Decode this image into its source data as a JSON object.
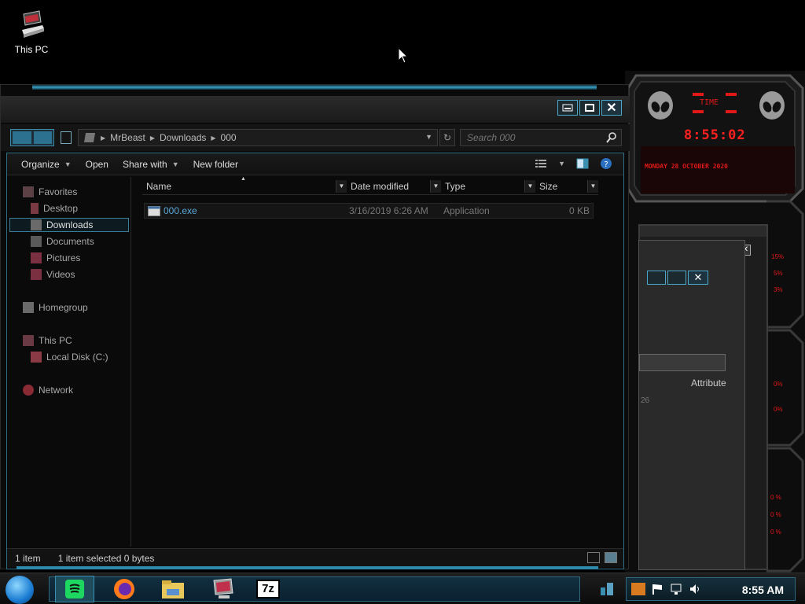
{
  "desktop": {
    "icons": [
      {
        "label": "This PC",
        "icon": "computer-icon"
      }
    ]
  },
  "gadget": {
    "time_label": "TIME",
    "time": "8:55:02",
    "date": "MONDAY 28 OCTOBER 2020",
    "meters": [
      "15%",
      "5%",
      "3%",
      "0%",
      "0%",
      "0 %",
      "0 %",
      "0 %"
    ],
    "colors": {
      "accent": "#e01818",
      "panel": "#1a1a1a"
    }
  },
  "back_window": {
    "column_header": "Attribute",
    "partial_value": "26"
  },
  "explorer": {
    "address": {
      "crumbs": [
        "MrBeast",
        "Downloads",
        "000"
      ]
    },
    "search": {
      "placeholder": "Search 000"
    },
    "toolbar": {
      "organize": "Organize",
      "open": "Open",
      "share_with": "Share with",
      "new_folder": "New folder"
    },
    "nav": {
      "favorites": "Favorites",
      "desktop": "Desktop",
      "downloads": "Downloads",
      "documents": "Documents",
      "pictures": "Pictures",
      "videos": "Videos",
      "homegroup": "Homegroup",
      "this_pc": "This PC",
      "local_disk": "Local Disk (C:)",
      "network": "Network"
    },
    "columns": {
      "name": "Name",
      "date": "Date modified",
      "type": "Type",
      "size": "Size"
    },
    "files": [
      {
        "name": "000.exe",
        "date": "3/16/2019 6:26 AM",
        "type": "Application",
        "size": "0 KB"
      }
    ],
    "status": {
      "count": "1 item",
      "selected": "1 item selected  0 bytes"
    },
    "colors": {
      "accent": "#3aa0c0",
      "link": "#5aa8d8"
    }
  },
  "taskbar": {
    "apps": [
      "spotify-icon",
      "firefox-icon",
      "file-explorer-icon",
      "monitor-app-icon",
      "7zip-icon"
    ],
    "sevenzip_label": "7z",
    "clock": "8:55 AM"
  }
}
